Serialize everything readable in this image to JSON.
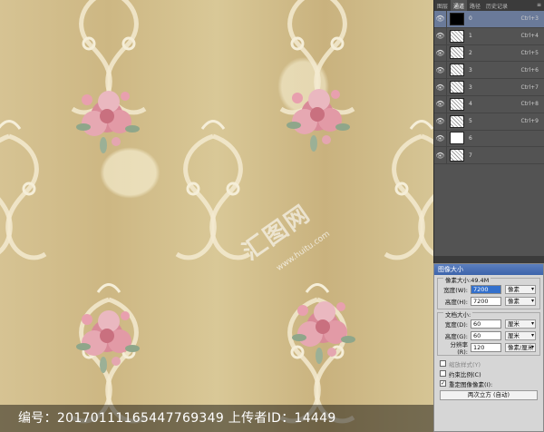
{
  "caption": {
    "text": "编号：20170111165447769349 上传者ID：14449"
  },
  "watermark": {
    "text": "汇图网",
    "sub": "www.huitu.com"
  },
  "panel": {
    "tabs": [
      "图层",
      "通道",
      "路径",
      "历史记录"
    ],
    "active_tab": 1,
    "menu_icon": "panel-menu-icon",
    "channels": [
      {
        "name": "0",
        "key": "Ctrl+3",
        "thumb": "black"
      },
      {
        "name": "1",
        "key": "Ctrl+4",
        "thumb": "pat"
      },
      {
        "name": "2",
        "key": "Ctrl+5",
        "thumb": "pat"
      },
      {
        "name": "3",
        "key": "Ctrl+6",
        "thumb": "pat"
      },
      {
        "name": "3",
        "key": "Ctrl+7",
        "thumb": "pat"
      },
      {
        "name": "4",
        "key": "Ctrl+8",
        "thumb": "pat"
      },
      {
        "name": "5",
        "key": "Ctrl+9",
        "thumb": "pat"
      },
      {
        "name": "6",
        "key": "",
        "thumb": "white"
      },
      {
        "name": "7",
        "key": "",
        "thumb": "pat"
      }
    ]
  },
  "dialog": {
    "title": "图像大小",
    "pixel_dims_label": "像素大小:49.4M",
    "width_label": "宽度(W):",
    "width_value": "7200",
    "height_label": "高度(H):",
    "height_value": "7200",
    "pixel_unit": "像素",
    "doc_size_label": "文档大小:",
    "doc_width_label": "宽度(D):",
    "doc_width_value": "60",
    "doc_height_label": "高度(G):",
    "doc_height_value": "60",
    "cm_unit": "厘米",
    "resolution_label": "分辨率(R):",
    "resolution_value": "120",
    "resolution_unit": "像素/厘米",
    "scale_styles": "缩放样式(Y)",
    "constrain": "约束比例(C)",
    "resample": "重定图像像素(I):",
    "resample_method": "两次立方 (自动)"
  }
}
